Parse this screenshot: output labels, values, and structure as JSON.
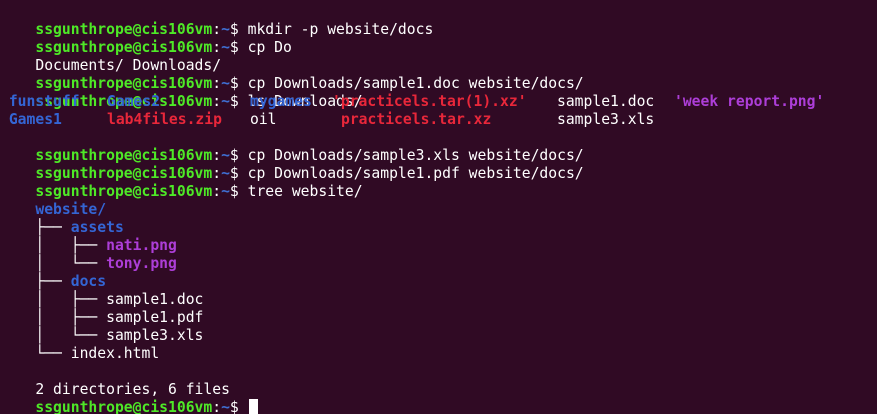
{
  "prompt": {
    "user_host": "ssgunthrope@cis106vm",
    "colon": ":",
    "path": "~",
    "symbol": "$"
  },
  "lines": {
    "l1_cmd": " mkdir -p website/docs",
    "l2_cmd": " cp Do",
    "l3_out": "Documents/ Downloads/",
    "l4_cmd": " cp Downloads/sample1.doc website/docs/",
    "l5_cmd": " ls Downloads/",
    "l8_cmd": " cp Downloads/sample3.xls website/docs/",
    "l9_cmd": " cp Downloads/sample1.pdf website/docs/",
    "l10_cmd": " tree website/",
    "summary": "2 directories, 6 files"
  },
  "ls_output": {
    "row1": {
      "c1": " funstuff",
      "c2": "Games2",
      "c3": "mygames",
      "c4": "'practicels.tar(1).xz'",
      "c5": "sample1.doc",
      "c6": "'week report.png'"
    },
    "row2": {
      "c1": " Games1",
      "c2": "lab4files.zip",
      "c3": "oil",
      "c4": "practicels.tar.xz",
      "c5": "sample3.xls"
    }
  },
  "tree": {
    "root": "website/",
    "branch_assets": "├── ",
    "assets": "assets",
    "assets_child1_prefix": "│   ├── ",
    "assets_child1": "nati.png",
    "assets_child2_prefix": "│   └── ",
    "assets_child2": "tony.png",
    "branch_docs": "├── ",
    "docs": "docs",
    "docs_child1_prefix": "│   ├── ",
    "docs_child1": "sample1.doc",
    "docs_child2_prefix": "│   ├── ",
    "docs_child2": "sample1.pdf",
    "docs_child3_prefix": "│   └── ",
    "docs_child3": "sample3.xls",
    "branch_index": "└── ",
    "index": "index.html"
  },
  "colors": {
    "background": "#300a24",
    "prompt_user": "#4ee927",
    "prompt_path": "#3f6fd3",
    "directory": "#3465d4",
    "image_file": "#ad3ed8",
    "archive_file": "#e8273a",
    "text": "#ffffff"
  }
}
